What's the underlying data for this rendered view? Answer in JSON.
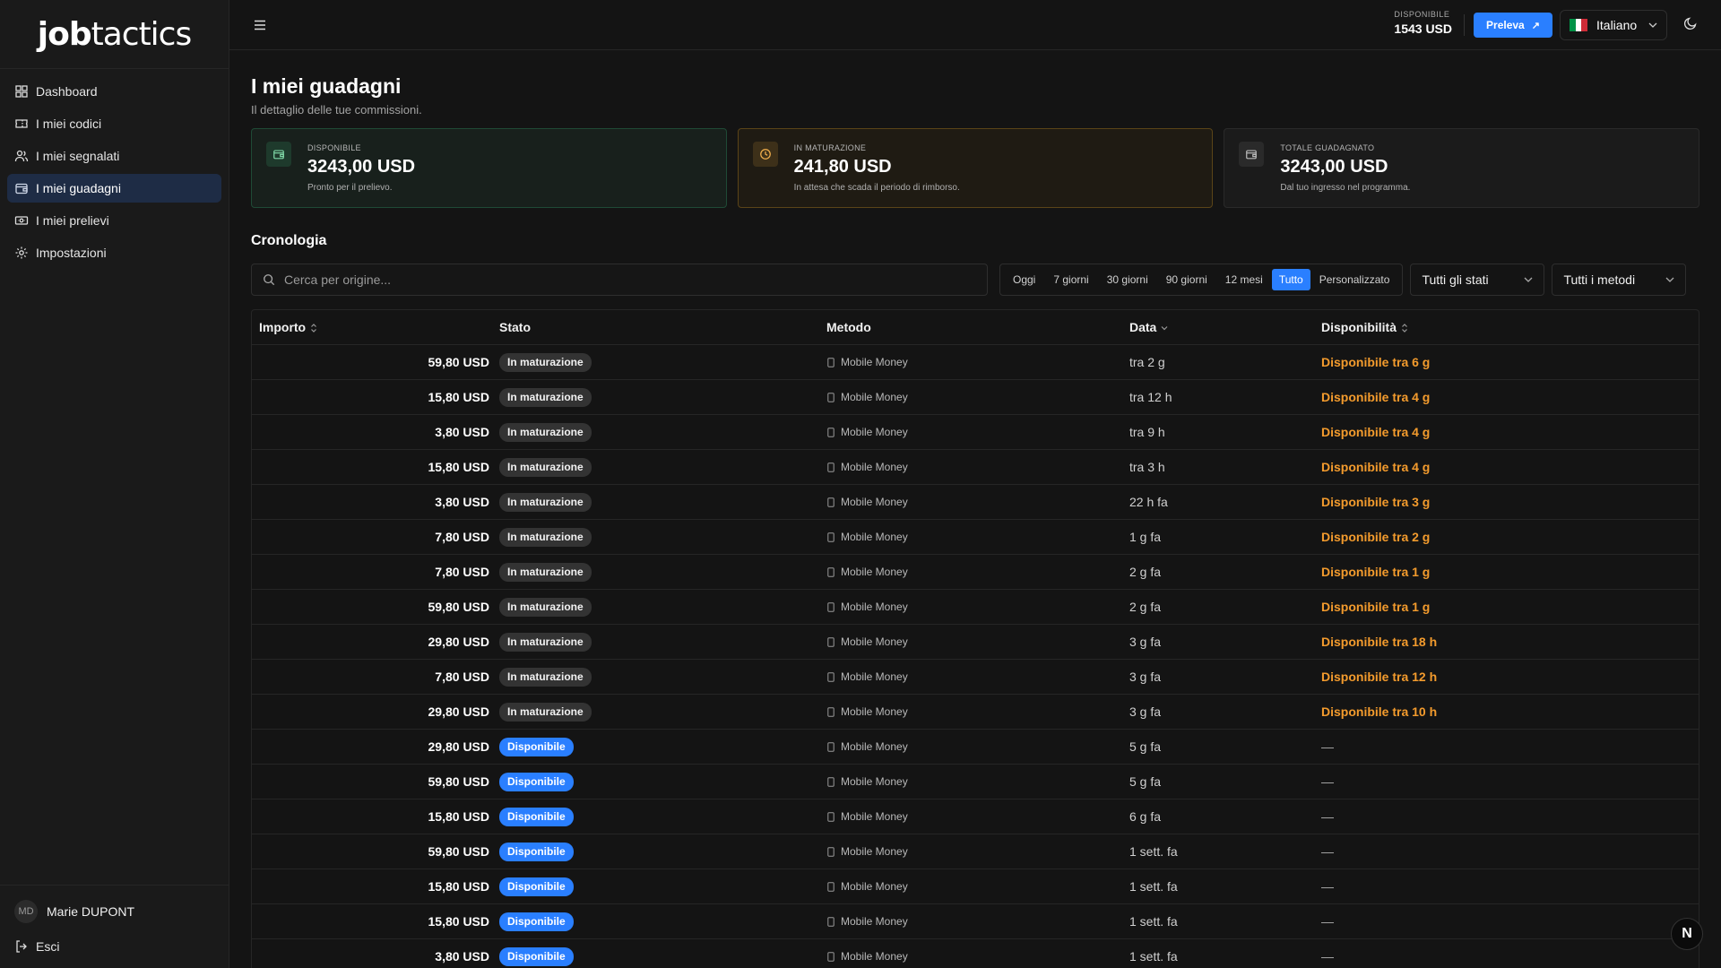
{
  "brand": {
    "part1": "job",
    "part2": "tactics"
  },
  "sidebar": {
    "items": [
      {
        "label": "Dashboard",
        "icon": "dashboard-icon"
      },
      {
        "label": "I miei codici",
        "icon": "ticket-icon"
      },
      {
        "label": "I miei segnalati",
        "icon": "users-icon"
      },
      {
        "label": "I miei guadagni",
        "icon": "wallet-icon"
      },
      {
        "label": "I miei prelievi",
        "icon": "banknote-icon"
      },
      {
        "label": "Impostazioni",
        "icon": "gear-icon"
      }
    ],
    "active_index": 3,
    "user": {
      "initials": "MD",
      "name": "Marie DUPONT"
    },
    "logout_label": "Esci"
  },
  "header": {
    "balance_label": "DISPONIBILE",
    "balance_value": "1543 USD",
    "withdraw_label": "Preleva",
    "language": "Italiano",
    "flag_colors": [
      "#009246",
      "#ffffff",
      "#ce2b37"
    ]
  },
  "page": {
    "title": "I miei guadagni",
    "subtitle": "Il dettaglio delle tue commissioni."
  },
  "cards": [
    {
      "label": "DISPONIBILE",
      "value": "3243,00 USD",
      "note": "Pronto per il prelievo."
    },
    {
      "label": "IN MATURAZIONE",
      "value": "241,80 USD",
      "note": "In attesa che scada il periodo di rimborso."
    },
    {
      "label": "TOTALE GUADAGNATO",
      "value": "3243,00 USD",
      "note": "Dal tuo ingresso nel programma."
    }
  ],
  "history": {
    "title": "Cronologia",
    "search_placeholder": "Cerca per origine...",
    "ranges": [
      "Oggi",
      "7 giorni",
      "30 giorni",
      "90 giorni",
      "12 mesi",
      "Tutto",
      "Personalizzato"
    ],
    "active_range": "Tutto",
    "status_filter": "Tutti gli stati",
    "method_filter": "Tutti i metodi",
    "columns": [
      "Importo",
      "Stato",
      "Metodo",
      "Data",
      "Disponibilità"
    ],
    "rows": [
      {
        "amount": "59,80 USD",
        "status": "In maturazione",
        "status_type": "maturing",
        "method": "Mobile Money",
        "date": "tra 2 g",
        "availability": "Disponibile tra 6 g"
      },
      {
        "amount": "15,80 USD",
        "status": "In maturazione",
        "status_type": "maturing",
        "method": "Mobile Money",
        "date": "tra 12 h",
        "availability": "Disponibile tra 4 g"
      },
      {
        "amount": "3,80 USD",
        "status": "In maturazione",
        "status_type": "maturing",
        "method": "Mobile Money",
        "date": "tra 9 h",
        "availability": "Disponibile tra 4 g"
      },
      {
        "amount": "15,80 USD",
        "status": "In maturazione",
        "status_type": "maturing",
        "method": "Mobile Money",
        "date": "tra 3 h",
        "availability": "Disponibile tra 4 g"
      },
      {
        "amount": "3,80 USD",
        "status": "In maturazione",
        "status_type": "maturing",
        "method": "Mobile Money",
        "date": "22 h fa",
        "availability": "Disponibile tra 3 g"
      },
      {
        "amount": "7,80 USD",
        "status": "In maturazione",
        "status_type": "maturing",
        "method": "Mobile Money",
        "date": "1 g fa",
        "availability": "Disponibile tra 2 g"
      },
      {
        "amount": "7,80 USD",
        "status": "In maturazione",
        "status_type": "maturing",
        "method": "Mobile Money",
        "date": "2 g fa",
        "availability": "Disponibile tra 1 g"
      },
      {
        "amount": "59,80 USD",
        "status": "In maturazione",
        "status_type": "maturing",
        "method": "Mobile Money",
        "date": "2 g fa",
        "availability": "Disponibile tra 1 g"
      },
      {
        "amount": "29,80 USD",
        "status": "In maturazione",
        "status_type": "maturing",
        "method": "Mobile Money",
        "date": "3 g fa",
        "availability": "Disponibile tra 18 h"
      },
      {
        "amount": "7,80 USD",
        "status": "In maturazione",
        "status_type": "maturing",
        "method": "Mobile Money",
        "date": "3 g fa",
        "availability": "Disponibile tra 12 h"
      },
      {
        "amount": "29,80 USD",
        "status": "In maturazione",
        "status_type": "maturing",
        "method": "Mobile Money",
        "date": "3 g fa",
        "availability": "Disponibile tra 10 h"
      },
      {
        "amount": "29,80 USD",
        "status": "Disponibile",
        "status_type": "available",
        "method": "Mobile Money",
        "date": "5 g fa",
        "availability": "—"
      },
      {
        "amount": "59,80 USD",
        "status": "Disponibile",
        "status_type": "available",
        "method": "Mobile Money",
        "date": "5 g fa",
        "availability": "—"
      },
      {
        "amount": "15,80 USD",
        "status": "Disponibile",
        "status_type": "available",
        "method": "Mobile Money",
        "date": "6 g fa",
        "availability": "—"
      },
      {
        "amount": "59,80 USD",
        "status": "Disponibile",
        "status_type": "available",
        "method": "Mobile Money",
        "date": "1 sett. fa",
        "availability": "—"
      },
      {
        "amount": "15,80 USD",
        "status": "Disponibile",
        "status_type": "available",
        "method": "Mobile Money",
        "date": "1 sett. fa",
        "availability": "—"
      },
      {
        "amount": "15,80 USD",
        "status": "Disponibile",
        "status_type": "available",
        "method": "Mobile Money",
        "date": "1 sett. fa",
        "availability": "—"
      },
      {
        "amount": "3,80 USD",
        "status": "Disponibile",
        "status_type": "available",
        "method": "Mobile Money",
        "date": "1 sett. fa",
        "availability": "—"
      }
    ]
  },
  "fab_label": "N",
  "colors": {
    "accent": "#2a7fff",
    "pending": "#f39b2d",
    "background": "#141414"
  }
}
